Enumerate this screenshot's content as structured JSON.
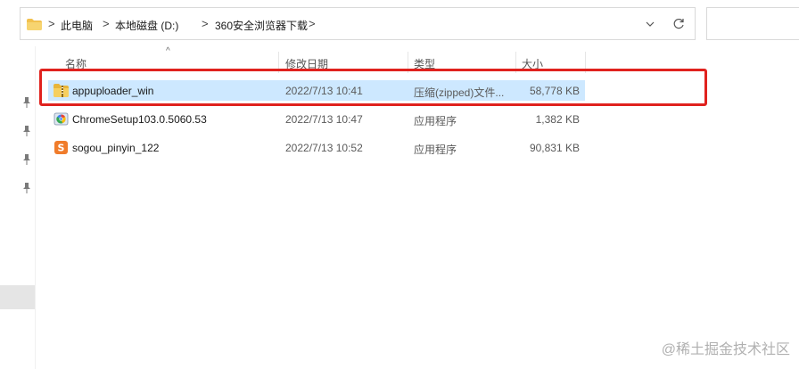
{
  "breadcrumb": {
    "items": [
      "此电脑",
      "本地磁盘 (D:)",
      "360安全浏览器下载"
    ],
    "separator": ">"
  },
  "columns": {
    "name": "名称",
    "date": "修改日期",
    "type": "类型",
    "size": "大小"
  },
  "files": [
    {
      "name": "appuploader_win",
      "date": "2022/7/13 10:41",
      "type": "压缩(zipped)文件...",
      "size": "58,778 KB",
      "icon": "zip-folder-icon",
      "selected": true
    },
    {
      "name": "ChromeSetup103.0.5060.53",
      "date": "2022/7/13 10:47",
      "type": "应用程序",
      "size": "1,382 KB",
      "icon": "chrome-setup-icon",
      "selected": false
    },
    {
      "name": "sogou_pinyin_122",
      "date": "2022/7/13 10:52",
      "type": "应用程序",
      "size": "90,831 KB",
      "icon": "sogou-icon",
      "selected": false
    }
  ],
  "watermark": "@稀土掘金技术社区",
  "colors": {
    "selection": "#cde8ff",
    "highlight_border": "#e0221e",
    "folder": "#f2c14e"
  }
}
